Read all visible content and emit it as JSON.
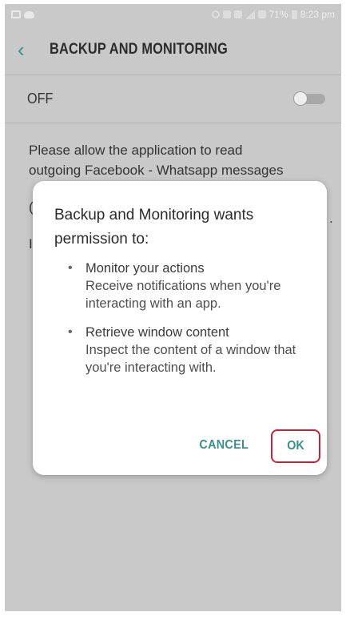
{
  "status_bar": {
    "battery_percent": "71%",
    "time": "8:23 pm",
    "text_color": "#eeeeee"
  },
  "header": {
    "title": "BACKUP AND MONITORING",
    "back_icon": "chevron-left-icon",
    "accent_color": "#3a8f90"
  },
  "setting": {
    "label": "OFF",
    "toggle_on": false
  },
  "background": {
    "line1": "Please allow the application to read",
    "line2": "outgoing Facebook - Whatsapp messages",
    "fragment_left_1": "(",
    "fragment_right": ".",
    "fragment_left_2": "I"
  },
  "dialog": {
    "title": "Backup and Monitoring wants permission to:",
    "bullet": "•",
    "permissions": [
      {
        "name": "Monitor your actions",
        "description": "Receive notifications when you're interacting with an app."
      },
      {
        "name": "Retrieve window content",
        "description": "Inspect the content of a window that you're interacting with."
      }
    ],
    "cancel_label": "CANCEL",
    "ok_label": "OK",
    "highlight_color": "#c0273a"
  }
}
